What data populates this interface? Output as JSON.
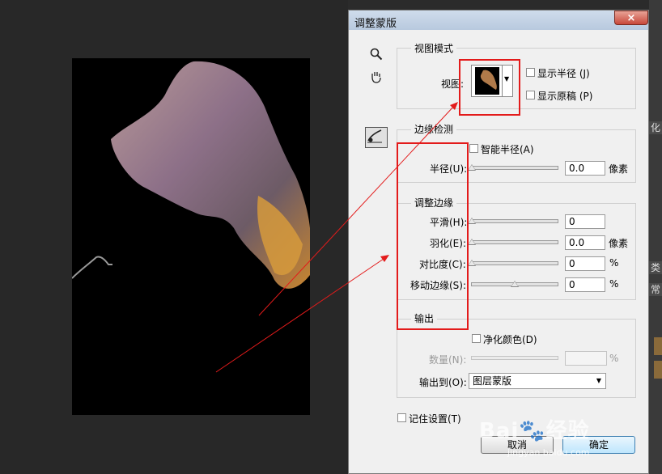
{
  "dialog": {
    "title": "调整蒙版",
    "close_glyph": "×"
  },
  "view_mode": {
    "group_title": "视图模式",
    "view_label": "视图:",
    "show_radius": "显示半径 (J)",
    "show_original": "显示原稿 (P)"
  },
  "edge_detection": {
    "group_title": "边缘检测",
    "smart_radius": "智能半径(A)",
    "radius_label": "半径(U):",
    "radius_value": "0.0",
    "radius_unit": "像素",
    "radius_fraction": 0
  },
  "adjust_edge": {
    "group_title": "调整边缘",
    "rows": [
      {
        "label": "平滑(H):",
        "value": "0",
        "unit": "",
        "fraction": 0
      },
      {
        "label": "羽化(E):",
        "value": "0.0",
        "unit": "像素",
        "fraction": 0
      },
      {
        "label": "对比度(C):",
        "value": "0",
        "unit": "%",
        "fraction": 0
      },
      {
        "label": "移动边缘(S):",
        "value": "0",
        "unit": "%",
        "fraction": 0.5
      }
    ]
  },
  "output": {
    "group_title": "输出",
    "decontaminate": "净化颜色(D)",
    "amount_label": "数量(N):",
    "amount_unit": "%",
    "output_to_label": "输出到(O):",
    "output_to_value": "图层蒙版"
  },
  "remember": "记住设置(T)",
  "buttons": {
    "cancel": "取消",
    "ok": "确定"
  },
  "watermark": {
    "brand": "Bai",
    "brand2": "经验",
    "url": "jingyan.baidu.com"
  },
  "side_panel": [
    "化",
    "类",
    "常"
  ],
  "colors": {
    "annotation": "#e31b1b",
    "ok_blue": "#3c7fb1"
  }
}
